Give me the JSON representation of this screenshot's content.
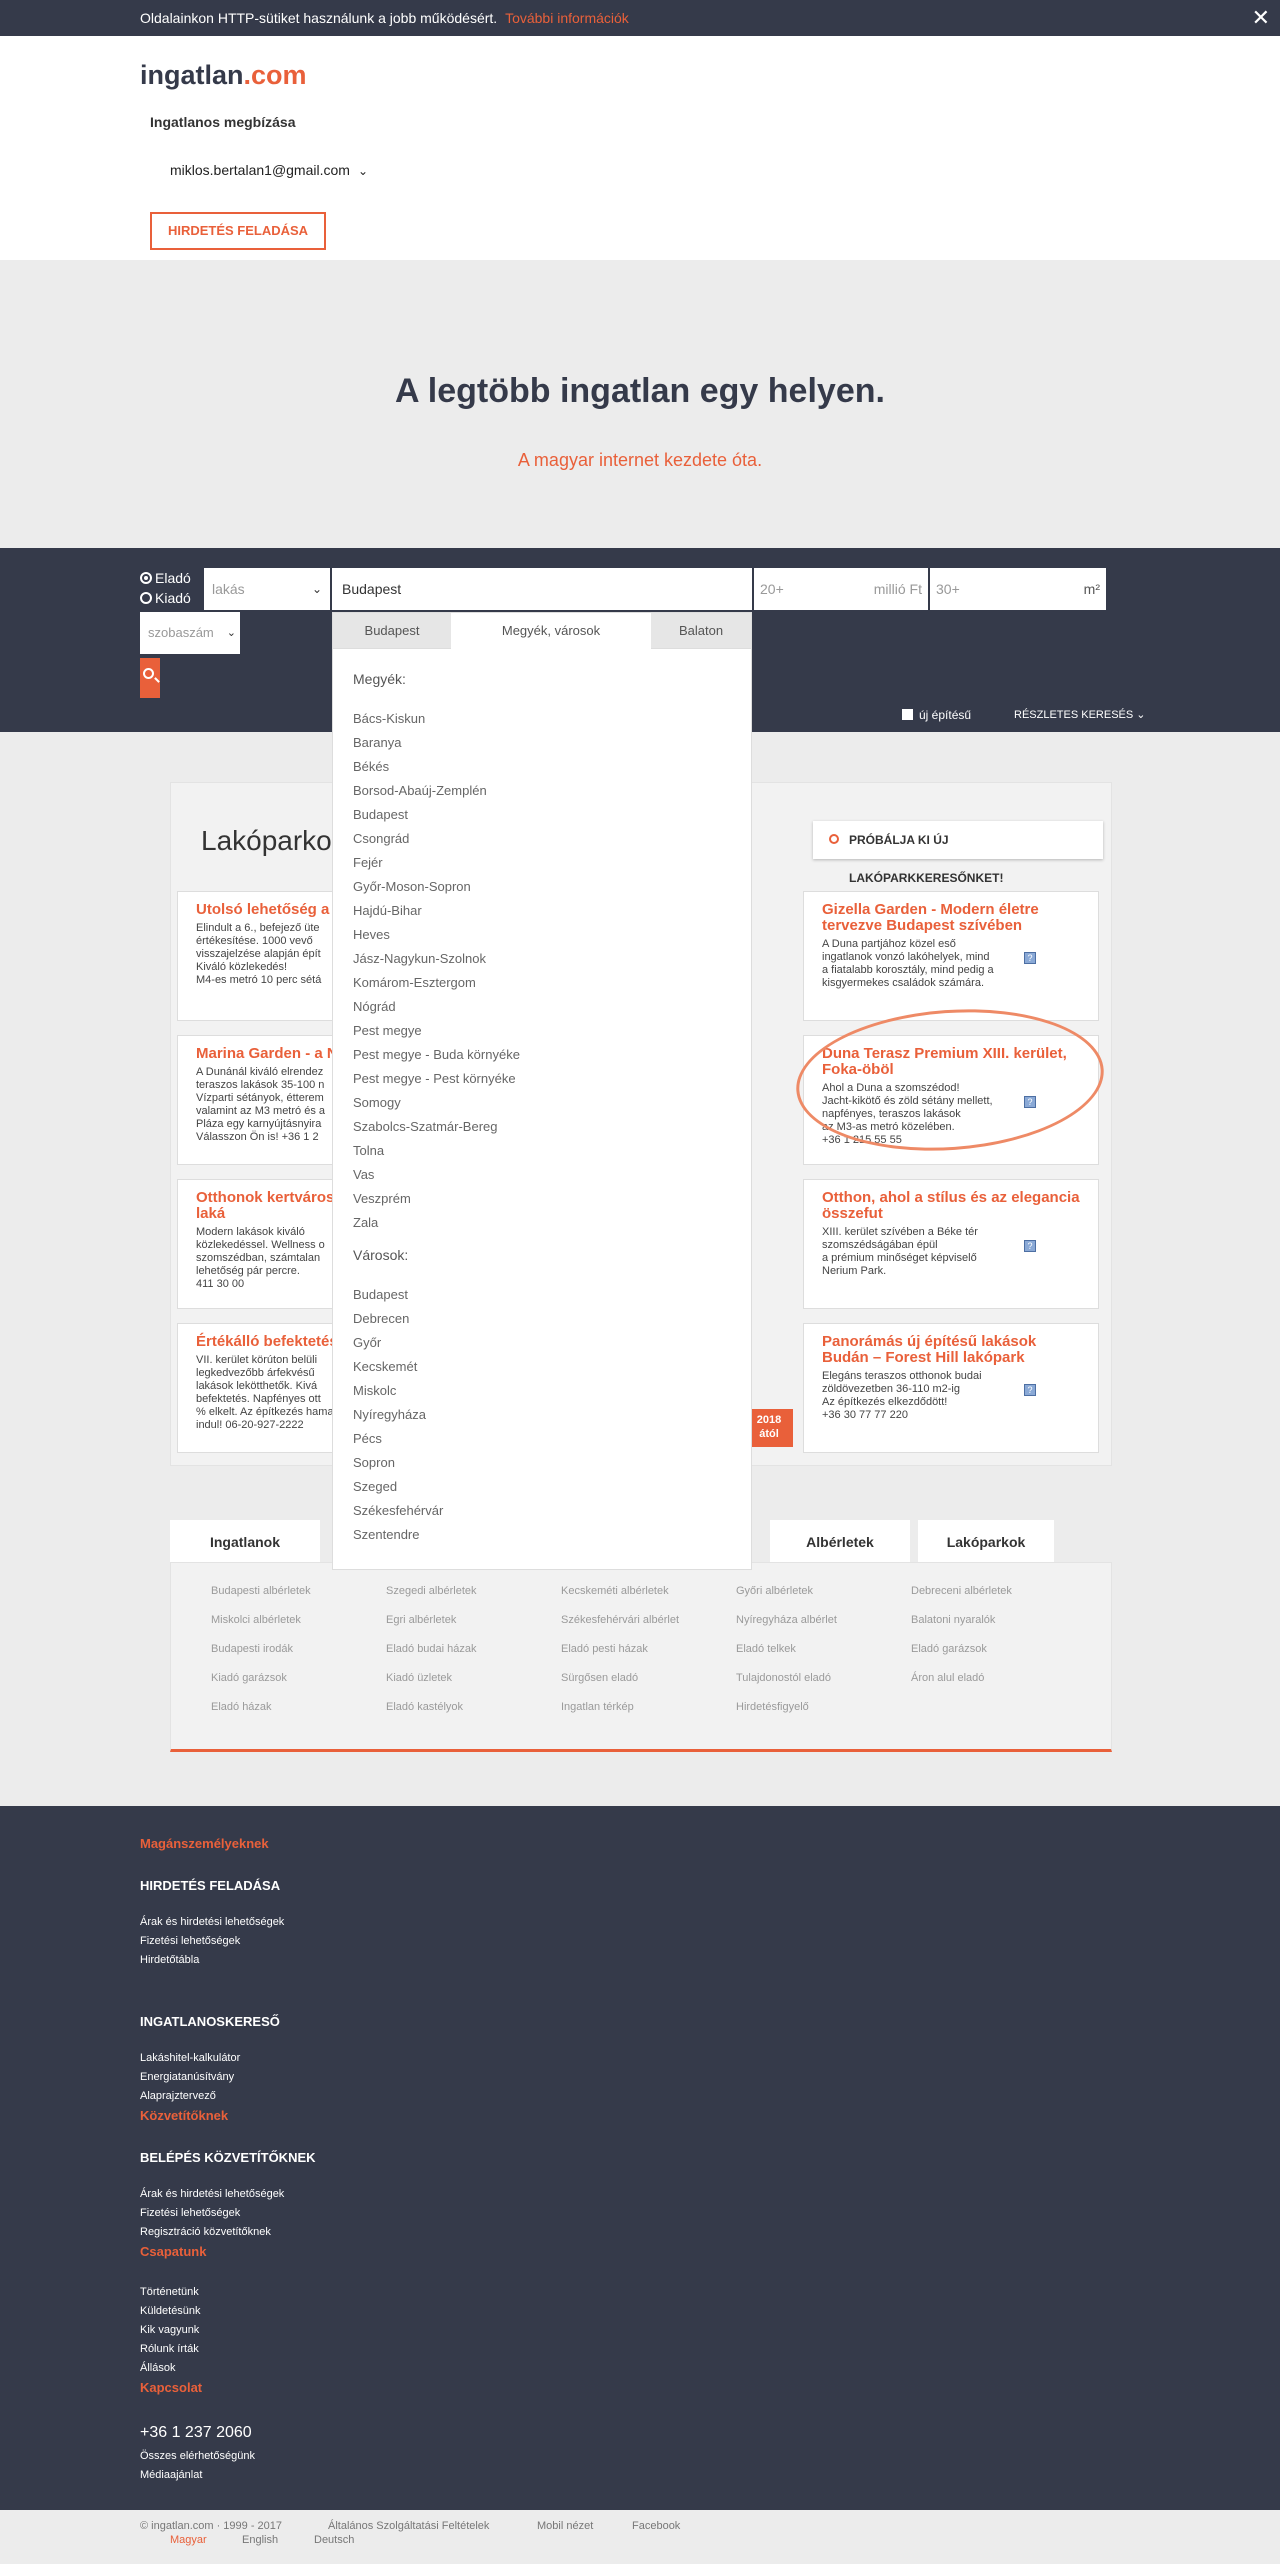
{
  "cookie": {
    "text": "Oldalainkon HTTP-sütiket használunk a jobb működésért.",
    "more": "További információk",
    "close": "✕"
  },
  "header": {
    "logo_part1": "ingatlan",
    "logo_part2": ".com",
    "subtitle": "Ingatlanos megbízása",
    "email": "miklos.bertalan1@gmail.com",
    "post_button": "HIRDETÉS FELADÁSA"
  },
  "hero": {
    "title": "A legtöbb ingatlan egy helyen.",
    "subtitle": "A magyar internet kezdete óta."
  },
  "search": {
    "radio_sale": "Eladó",
    "radio_rent": "Kiadó",
    "type_value": "lakás",
    "location_value": "Budapest",
    "price_placeholder": "20+",
    "price_unit": "millió Ft",
    "area_placeholder": "30+",
    "area_unit": "m²",
    "rooms_placeholder": "szobaszám",
    "new_build": "új építésű",
    "details": "RÉSZLETES KERESÉS ⌄"
  },
  "dropdown": {
    "tabs": [
      "Budapest",
      "Megyék, városok",
      "Balaton"
    ],
    "counties_heading": "Megyék:",
    "counties": [
      "Bács-Kiskun",
      "Baranya",
      "Békés",
      "Borsod-Abaúj-Zemplén",
      "Budapest",
      "Csongrád",
      "Fejér",
      "Győr-Moson-Sopron",
      "Hajdú-Bihar",
      "Heves",
      "Jász-Nagykun-Szolnok",
      "Komárom-Esztergom",
      "Nógrád",
      "Pest megye",
      "Pest megye - Buda környéke",
      "Pest megye - Pest környéke",
      "Somogy",
      "Szabolcs-Szatmár-Bereg",
      "Tolna",
      "Vas",
      "Veszprém",
      "Zala"
    ],
    "cities_heading": "Városok:",
    "cities": [
      "Budapest",
      "Debrecen",
      "Győr",
      "Kecskemét",
      "Miskolc",
      "Nyíregyháza",
      "Pécs",
      "Sopron",
      "Szeged",
      "Székesfehérvár",
      "Szentendre"
    ]
  },
  "lakoparkok": {
    "title": "Lakóparko",
    "try_button": "PRÓBÁLJA KI ÚJ LAKÓPARKKERESŐNKET!",
    "badge_2018_line1": "2018",
    "badge_2018_line2": "ától",
    "cards_left": [
      {
        "title": "Utolsó lehetőség a Ligetben!",
        "desc": "Elindult a 6., befejező üte\nértékesítése. 1000 vevő\nvisszajelzése alapján épít\nKiváló közlekedés!\nM4-es metró 10 perc sétá"
      },
      {
        "title": "Marina Garden - a N",
        "desc": "A Dunánál kiváló elrendez\nteraszos lakások 35-100 n\nVízparti sétányok, étterem\nvalamint az M3 metró és a\nPláza egy karnyújtásnyira\nVálasszon Ön is! +36 1 2"
      },
      {
        "title": "Otthonok kertváros Thermal Zugló laká",
        "desc": "Modern lakások kiváló\nközlekedéssel. Wellness o\nszomszédban, számtalan\nlehetőség pár percre.\n411 30 00"
      },
      {
        "title": "Értékálló befektetés",
        "desc": "VII. kerület körúton belüli\nlegkedvezőbb árfekvésű\nlakások lekötthetők. Kivá\nbefektetés. Napfényes ott\n% elkelt. Az építkezés hamarosan\nindul! 06-20-927-2222"
      }
    ],
    "cards_right": [
      {
        "title": "Gizella Garden - Modern életre tervezve Budapest szívében",
        "desc": "A Duna partjához közel eső\ningatlanok vonzó lakóhelyek, mind\na fiatalabb korosztály, mind pedig a\nkisgyermekes családok számára."
      },
      {
        "title": "Duna Terasz Premium XIII. kerület, Foka-öböl",
        "desc": "Ahol a Duna a szomszédod!\nJacht-kikötő és zöld sétány mellett,\nnapfényes, teraszos lakások\naz M3-as metró közelében.\n+36 1 215 55 55"
      },
      {
        "title": "Otthon, ahol a stílus és az elegancia összefut",
        "desc": "XIII. kerület szívében a Béke tér\nszomszédságában épül\na prémium minőséget képviselő\nNerium Park."
      },
      {
        "title": "Panorámás új építésű lakások Budán – Forest Hill lakópark",
        "desc": "Elegáns teraszos otthonok budai\nzöldövezetben 36-110 m2-ig\nAz építkezés elkezdődött!\n+36 30 77 77 220"
      }
    ]
  },
  "links": {
    "tabs": [
      "Ingatlanok",
      "Albérletek",
      "Lakóparkok"
    ],
    "columns": [
      [
        "Budapesti albérletek",
        "Miskolci albérletek",
        "Budapesti irodák",
        "Kiadó garázsok",
        "Eladó házak"
      ],
      [
        "Szegedi albérletek",
        "Egri albérletek",
        "Eladó budai házak",
        "Kiadó üzletek",
        "Eladó kastélyok"
      ],
      [
        "Kecskeméti albérletek",
        "Székesfehérvári albérlet",
        "Eladó pesti házak",
        "Sürgősen eladó",
        "Ingatlan térkép"
      ],
      [
        "Győri albérletek",
        "Nyíregyháza albérlet",
        "Eladó telkek",
        "Tulajdonostól eladó",
        "Hirdetésfigyelő"
      ],
      [
        "Debreceni albérletek",
        "Balatoni nyaralók",
        "Eladó garázsok",
        "Áron alul eladó"
      ]
    ]
  },
  "footer": {
    "private_heading": "Magánszemélyeknek",
    "sec1_heading": "HIRDETÉS FELADÁSA",
    "sec1_links": [
      "Árak és hirdetési lehetőségek",
      "Fizetési lehetőségek",
      "Hirdetőtábla"
    ],
    "sec2_heading": "INGATLANOSKERESŐ",
    "sec2_links": [
      "Lakáshitel-kalkulátor",
      "Energiatanúsítvány",
      "Alaprajztervező"
    ],
    "agents_heading": "Közvetítőknek",
    "sec3_heading": "BELÉPÉS KÖZVETÍTŐKNEK",
    "sec3_links": [
      "Árak és hirdetési lehetőségek",
      "Fizetési lehetőségek",
      "Regisztráció közvetítőknek"
    ],
    "team_heading": "Csapatunk",
    "team_links": [
      "Történetünk",
      "Küldetésünk",
      "Kik vagyunk",
      "Rólunk írták",
      "Állások"
    ],
    "contact_heading": "Kapcsolat",
    "phone": "+36 1 237 2060",
    "contact_links": [
      "Összes elérhetőségünk",
      "Médiaajánlat"
    ],
    "copyright": "© ingatlan.com · 1999 - 2017",
    "terms": "Általános Szolgáltatási Feltételek",
    "mobile": "Mobil nézet",
    "facebook": "Facebook",
    "languages": [
      "Magyar",
      "English",
      "Deutsch"
    ]
  },
  "colors": {
    "accent": "#e9603a",
    "dark": "#353a4a",
    "background": "#ececec"
  }
}
